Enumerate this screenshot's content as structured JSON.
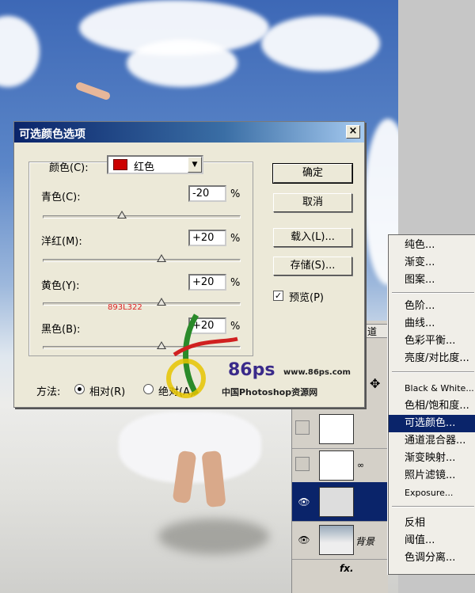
{
  "dialog": {
    "title": "可选颜色选项",
    "close": "×",
    "colors_label": "颜色(C):",
    "colors_value": "红色",
    "swatch_color": "#cc0000",
    "sliders": [
      {
        "label": "青色(C):",
        "value": "-20",
        "unit": "%",
        "level": 0.4
      },
      {
        "label": "洋红(M):",
        "value": "+20",
        "unit": "%",
        "level": 0.6
      },
      {
        "label": "黄色(Y):",
        "value": "+20",
        "unit": "%",
        "level": 0.6
      },
      {
        "label": "黑色(B):",
        "value": "+20",
        "unit": "%",
        "level": 0.6
      }
    ],
    "buttons": {
      "ok": "确定",
      "cancel": "取消",
      "load": "载入(L)...",
      "save": "存储(S)..."
    },
    "preview": {
      "label": "预览(P)",
      "checked": true
    },
    "method": {
      "label": "方法:",
      "relative": "相对(R)",
      "absolute": "绝对(A)",
      "selected": "relative"
    }
  },
  "menu": {
    "groups": [
      [
        "纯色...",
        "渐变...",
        "图案..."
      ],
      [
        "色阶...",
        "曲线...",
        "色彩平衡...",
        "亮度/对比度..."
      ],
      [
        "Black & White...",
        "色相/饱和度...",
        "可选颜色...",
        "通道混合器...",
        "渐变映射...",
        "照片滤镜...",
        "Exposure..."
      ],
      [
        "反相",
        "阈值...",
        "色调分离..."
      ]
    ],
    "selected": "可选颜色..."
  },
  "layers": {
    "tab_fragment": "道",
    "background_name": "背景",
    "footer": "fx."
  },
  "watermark": {
    "brand": "86ps",
    "url": "www.86ps.com",
    "site": "中国Photoshop资源网",
    "stamp": "893L322"
  }
}
